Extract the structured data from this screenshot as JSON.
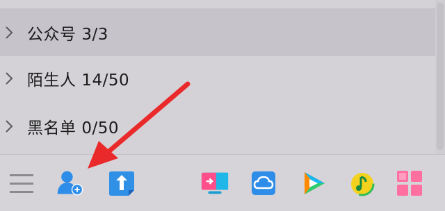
{
  "groups": [
    {
      "name": "公众号",
      "count": "3/3",
      "active": true
    },
    {
      "name": "陌生人",
      "count": "14/50",
      "active": false
    },
    {
      "name": "黑名单",
      "count": "0/50",
      "active": false
    }
  ],
  "toolbar": {
    "left_icons": [
      "menu-icon",
      "add-contact-icon",
      "transfer-icon"
    ],
    "right_icons": [
      "screen-share-icon",
      "cloud-icon",
      "video-icon",
      "music-icon",
      "app-manager-icon"
    ]
  },
  "colors": {
    "accent_blue": "#2e8de8",
    "arrow_red": "#ea2a2a"
  }
}
